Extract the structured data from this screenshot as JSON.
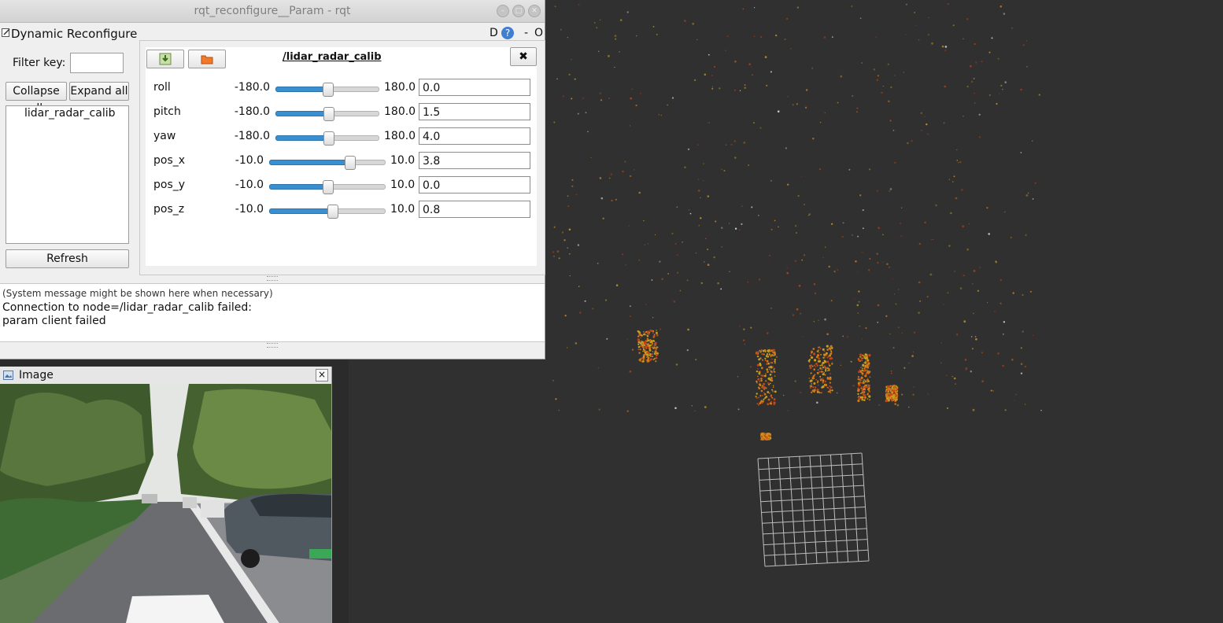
{
  "window": {
    "title": "rqt_reconfigure__Param - rqt",
    "buttons": [
      "minimize-button",
      "maximize-button",
      "close-button"
    ]
  },
  "plugin_bar": {
    "title": "Dynamic Reconfigure",
    "d_label": "D",
    "help_label": "?",
    "dash_label": "-",
    "o_label": "O"
  },
  "left_panel": {
    "filter_label": "Filter key:",
    "filter_value": "",
    "collapse_label": "Collapse all",
    "expand_label": "Expand all",
    "tree_items": [
      "lidar_radar_calib"
    ],
    "refresh_label": "Refresh"
  },
  "param_panel": {
    "node_title": "/lidar_radar_calib",
    "params": [
      {
        "name": "roll",
        "min": "-180.0",
        "max": "180.0",
        "value": "0.0"
      },
      {
        "name": "pitch",
        "min": "-180.0",
        "max": "180.0",
        "value": "1.5"
      },
      {
        "name": "yaw",
        "min": "-180.0",
        "max": "180.0",
        "value": "4.0"
      },
      {
        "name": "pos_x",
        "min": "-10.0",
        "max": "10.0",
        "value": "3.8"
      },
      {
        "name": "pos_y",
        "min": "-10.0",
        "max": "10.0",
        "value": "0.0"
      },
      {
        "name": "pos_z",
        "min": "-10.0",
        "max": "10.0",
        "value": "0.8"
      }
    ]
  },
  "messages": {
    "hint": "(System message might be shown here when necessary)",
    "line1": "Connection to node=/lidar_radar_calib failed:",
    "line2": "param client failed"
  },
  "image_panel": {
    "title": "Image",
    "close_label": "×"
  },
  "colors": {
    "viewport_bg": "#303030",
    "slider_fill": "#3a8fd0",
    "window_bg": "#efefef"
  }
}
